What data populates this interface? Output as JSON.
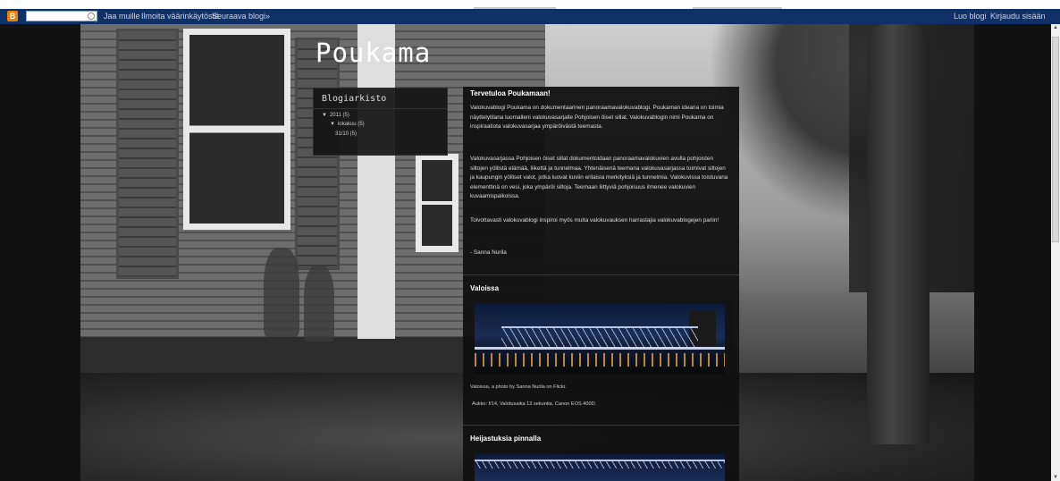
{
  "navbar": {
    "logo": "B",
    "search_placeholder": "",
    "links": [
      "Jaa muille",
      "Ilmoita väärinkäytöstä",
      "Seuraava blogi»"
    ],
    "right_links": [
      "Luo blogi",
      "Kirjaudu sisään"
    ]
  },
  "blog": {
    "title": "Poukama"
  },
  "archive": {
    "heading": "Blogiarkisto",
    "year": "2011 (5)",
    "month": "lokakuu (5)",
    "day": "31/10 (5)"
  },
  "post1": {
    "title": "Tervetuloa Poukamaan!",
    "p1": "Valokuvablogi Poukama on dokumentaarinen panoraamavalokuvablogi. Poukaman ideana on toimia näyttelytilana luomalleni valokuvasarjalle Pohjoisen öiset sillat. Valokuvablogin nimi Poukama on inspiraatiota valokuvasarjaa ympäröivästä teemasta.",
    "p2": "Valokuvasarjassa Pohjoisen öiset sillat dokumentoidaan panoraamavalokuvien avulla pohjoisten siltojen yöllistä elämää, liikettä ja tunnelmaa. Yhtenäisenä teemana valokuvasarjassa toimivat siltojen ja kaupungin yölliset valot, jotka luovat kuviin erilaisia merkityksiä ja tunnelmia. Valokuvissa toistuvana elementtinä on vesi, joka ympäröi siltoja. Teemaan liittyviä pohjoisuus ilmenee valokuvien kuvaamispaikoissa.",
    "p3": "Toivottavasti valokuvablogi inspiroi myös muita valokuvauksen harrastajia valokuvablogejen pariin!",
    "signature": "- Sanna Nurila"
  },
  "post2": {
    "title": "Valoissa",
    "caption": "Valoissa, a photo by Sanna Nurila on Flickr.",
    "exif": "Aukko: f/14, Valotusaika 13 sekuntia. Canon EOS 400D."
  },
  "post3": {
    "title": "Heijastuksia pinnalla"
  },
  "colors": {
    "navbar": "#0f3167",
    "page_bg": "#111111",
    "accent_logo": "#f57d00"
  }
}
